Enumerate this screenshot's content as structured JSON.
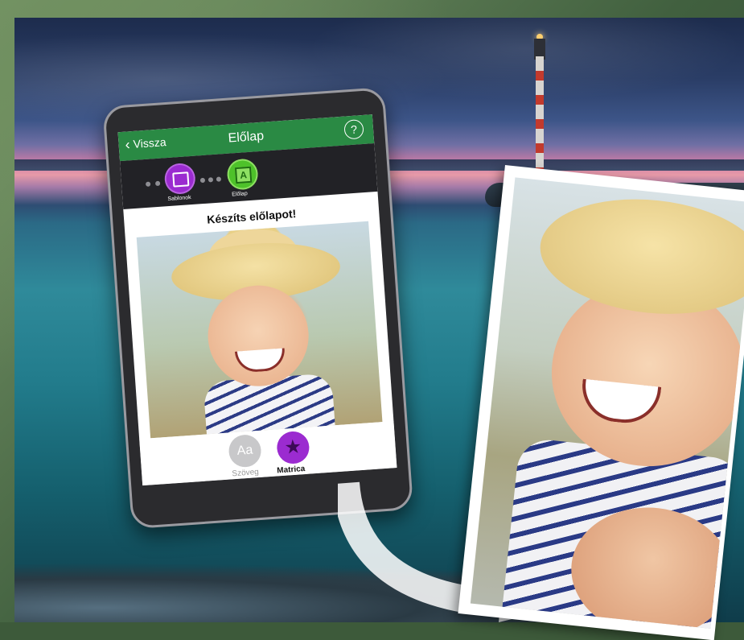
{
  "app": {
    "nav": {
      "back_label": "Vissza",
      "title": "Előlap",
      "help_label": "?"
    },
    "steps": [
      {
        "label": "Sablonok",
        "icon": "template-icon",
        "color": "#9b2bd0"
      },
      {
        "label": "Előlap",
        "icon": "front-page-icon",
        "icon_text": "A",
        "color": "#4ec22a"
      }
    ],
    "heading": "Készíts előlapot!",
    "tools": [
      {
        "label": "Szöveg",
        "icon_text": "Aa",
        "icon": "text-icon",
        "color": "#c8c8ca"
      },
      {
        "label": "Matrica",
        "icon_text": "★",
        "icon": "star-sticker-icon",
        "color": "#9b2bd0"
      }
    ]
  },
  "colors": {
    "nav_green": "#2a8a44",
    "accent_purple": "#9b2bd0",
    "accent_green": "#4ec22a"
  }
}
